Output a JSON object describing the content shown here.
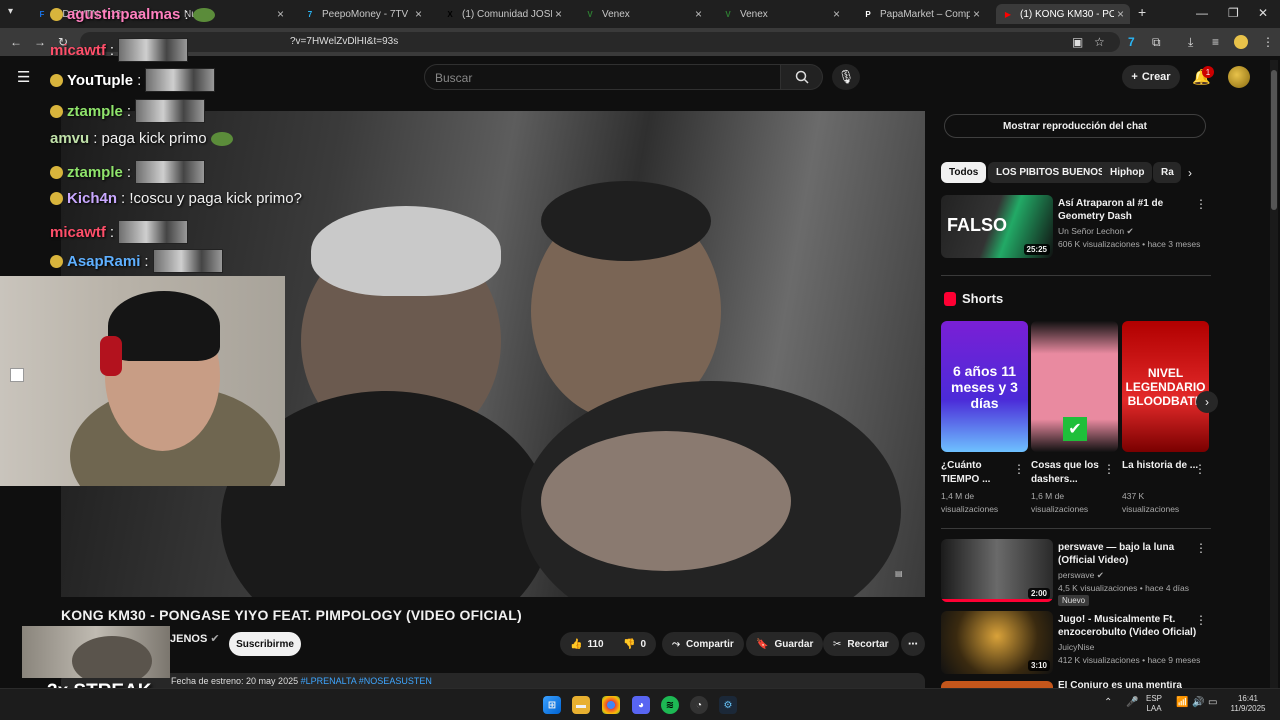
{
  "browser": {
    "tabs": [
      {
        "label": "MD PVTN 7:12",
        "fav": "F",
        "fav_color": "#1a73e8"
      },
      {
        "label": "Nuevo",
        "fav": "",
        "fav_color": "#888888"
      },
      {
        "label": "PeepoMoney - 7TV",
        "fav": "7",
        "fav_color": "#29b6f6"
      },
      {
        "label": "(1) Comunidad JOSEO EX",
        "fav": "X",
        "fav_color": "#000000"
      },
      {
        "label": "Venex",
        "fav": "V",
        "fav_color": "#2e7d32"
      },
      {
        "label": "Venex",
        "fav": "V",
        "fav_color": "#2e7d32"
      },
      {
        "label": "PapaMarket – Compra y v",
        "fav": "P",
        "fav_color": "#ffffff"
      },
      {
        "label": "(1) KONG KM30 - PO",
        "fav": "▶",
        "fav_color": "#ff0000"
      }
    ],
    "url": "?v=7HWelZvDlHI&t=93s"
  },
  "youtube": {
    "search_placeholder": "Buscar",
    "create_label": "Crear",
    "notif_count": "1"
  },
  "video": {
    "title": "KONG KM30 - PONGASE YIYO FEAT. PIMPOLOGY (VIDEO OFICIAL)",
    "channel": "JENOS",
    "subscribe_label": "Suscribirme",
    "likes": "110",
    "dislikes": "0",
    "share_label": "Compartir",
    "save_label": "Guardar",
    "clip_label": "Recortar",
    "desc_meta": "Fecha de estreno: 20 may 2025",
    "desc_tags": "#LPRENALTA #NOSEASUSTEN"
  },
  "sidebar": {
    "chat_replay_label": "Mostrar reproducción del chat",
    "chips": [
      "Todos",
      "LOS PIBITOS BUENOS",
      "Hiphop",
      "Ra"
    ],
    "videos": [
      {
        "title": "Así Atraparon al #1 de Geometry Dash",
        "channel": "Un Señor Lechon",
        "meta": "606 K visualizaciones • hace 3 meses",
        "duration": "25:25",
        "thumb_text": "FALSO"
      },
      {
        "title": "perswave — bajo la luna (Official Video)",
        "channel": "perswave",
        "meta": "4,5 K visualizaciones • hace 4 días",
        "duration": "2:00",
        "badge": "Nuevo"
      },
      {
        "title": "Jugo! - Musicalmente Ft. enzocerobulto (Video Oficial)",
        "channel": "JuicyNise",
        "meta": "412 K visualizaciones • hace 9 meses",
        "duration": "3:10"
      },
      {
        "title": "El Conjuro es una mentira",
        "channel": "",
        "meta": "",
        "duration": ""
      }
    ],
    "shorts_label": "Shorts",
    "shorts": [
      {
        "title": "¿Cuánto TIEMPO ...",
        "views": "1,4 M de visualizaciones",
        "thumb_text": "6 años 11 meses y 3 días"
      },
      {
        "title": "Cosas que los dashers...",
        "views": "1,6 M de visualizaciones",
        "thumb_text": ""
      },
      {
        "title": "La historia de ...",
        "views": "437 K visualizaciones",
        "thumb_text": "NIVEL LEGENDARIO BLOODBATH"
      }
    ]
  },
  "stream_overlay": {
    "chat": [
      {
        "user": "agustinpaalmas",
        "text": ":",
        "color": "#ff7fbf"
      },
      {
        "user": "micawtf",
        "text": ":",
        "color": "#ff4f6a"
      },
      {
        "user": "YouTuple",
        "text": ":",
        "color": "#ffffff"
      },
      {
        "user": "ztample",
        "text": ":",
        "color": "#8fe36b"
      },
      {
        "user": "amvu",
        "text": ": paga kick primo",
        "color": "#bfe0a8"
      },
      {
        "user": "ztample",
        "text": ":",
        "color": "#8fe36b"
      },
      {
        "user": "Kich4n",
        "text": ": !coscu y paga kick primo?",
        "color": "#c9a8ff"
      },
      {
        "user": "micawtf",
        "text": ":",
        "color": "#ff4f6a"
      },
      {
        "user": "AsapRami",
        "text": ":",
        "color": "#5fb0ff"
      }
    ],
    "streak": "3x STREAK"
  },
  "taskbar": {
    "lang": "ESP",
    "lang2": "LAA",
    "time": "16:41",
    "date": "11/9/2025"
  }
}
